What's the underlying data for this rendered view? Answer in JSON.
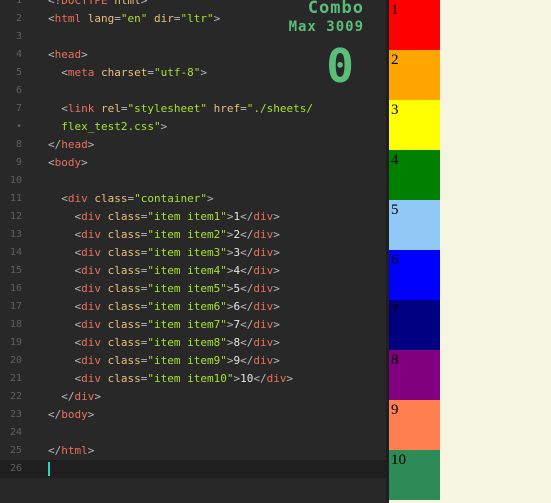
{
  "editor": {
    "lines": [
      {
        "n": "1",
        "segments": [
          [
            "p",
            "<!"
          ],
          [
            "t",
            "DOCTYPE"
          ],
          [
            "x",
            " "
          ],
          [
            "a",
            "html"
          ],
          [
            "p",
            ">"
          ]
        ]
      },
      {
        "n": "2",
        "segments": [
          [
            "p",
            "<"
          ],
          [
            "t",
            "html"
          ],
          [
            "x",
            " "
          ],
          [
            "a",
            "lang"
          ],
          [
            "p",
            "="
          ],
          [
            "s",
            "\"en\""
          ],
          [
            "x",
            " "
          ],
          [
            "a",
            "dir"
          ],
          [
            "p",
            "="
          ],
          [
            "s",
            "\"ltr\""
          ],
          [
            "p",
            ">"
          ]
        ]
      },
      {
        "n": "3",
        "segments": []
      },
      {
        "n": "4",
        "segments": [
          [
            "p",
            "<"
          ],
          [
            "t",
            "head"
          ],
          [
            "p",
            ">"
          ]
        ]
      },
      {
        "n": "5",
        "segments": [
          [
            "x",
            "  "
          ],
          [
            "p",
            "<"
          ],
          [
            "t",
            "meta"
          ],
          [
            "x",
            " "
          ],
          [
            "a",
            "charset"
          ],
          [
            "p",
            "="
          ],
          [
            "s",
            "\"utf-8\""
          ],
          [
            "p",
            ">"
          ]
        ]
      },
      {
        "n": "6",
        "segments": []
      },
      {
        "n": "7",
        "segments": [
          [
            "x",
            "  "
          ],
          [
            "p",
            "<"
          ],
          [
            "t",
            "link"
          ],
          [
            "x",
            " "
          ],
          [
            "a",
            "rel"
          ],
          [
            "p",
            "="
          ],
          [
            "s",
            "\"stylesheet\""
          ],
          [
            "x",
            " "
          ],
          [
            "a",
            "href"
          ],
          [
            "p",
            "="
          ],
          [
            "s",
            "\"./sheets/"
          ]
        ]
      },
      {
        "n": "•",
        "segments": [
          [
            "s",
            "  flex_test2.css\""
          ],
          [
            "p",
            ">"
          ]
        ]
      },
      {
        "n": "8",
        "segments": [
          [
            "p",
            "</"
          ],
          [
            "t",
            "head"
          ],
          [
            "p",
            ">"
          ]
        ]
      },
      {
        "n": "9",
        "segments": [
          [
            "p",
            "<"
          ],
          [
            "t",
            "body"
          ],
          [
            "p",
            ">"
          ]
        ]
      },
      {
        "n": "10",
        "segments": []
      },
      {
        "n": "11",
        "segments": [
          [
            "x",
            "  "
          ],
          [
            "p",
            "<"
          ],
          [
            "t",
            "div"
          ],
          [
            "x",
            " "
          ],
          [
            "a",
            "class"
          ],
          [
            "p",
            "="
          ],
          [
            "s",
            "\"container\""
          ],
          [
            "p",
            ">"
          ]
        ]
      },
      {
        "n": "12",
        "segments": [
          [
            "x",
            "    "
          ],
          [
            "p",
            "<"
          ],
          [
            "t",
            "div"
          ],
          [
            "x",
            " "
          ],
          [
            "a",
            "class"
          ],
          [
            "p",
            "="
          ],
          [
            "s",
            "\"item item1\""
          ],
          [
            "p",
            ">"
          ],
          [
            "x",
            "1"
          ],
          [
            "p",
            "</"
          ],
          [
            "t",
            "div"
          ],
          [
            "p",
            ">"
          ]
        ]
      },
      {
        "n": "13",
        "segments": [
          [
            "x",
            "    "
          ],
          [
            "p",
            "<"
          ],
          [
            "t",
            "div"
          ],
          [
            "x",
            " "
          ],
          [
            "a",
            "class"
          ],
          [
            "p",
            "="
          ],
          [
            "s",
            "\"item item2\""
          ],
          [
            "p",
            ">"
          ],
          [
            "x",
            "2"
          ],
          [
            "p",
            "</"
          ],
          [
            "t",
            "div"
          ],
          [
            "p",
            ">"
          ]
        ]
      },
      {
        "n": "14",
        "segments": [
          [
            "x",
            "    "
          ],
          [
            "p",
            "<"
          ],
          [
            "t",
            "div"
          ],
          [
            "x",
            " "
          ],
          [
            "a",
            "class"
          ],
          [
            "p",
            "="
          ],
          [
            "s",
            "\"item item3\""
          ],
          [
            "p",
            ">"
          ],
          [
            "x",
            "3"
          ],
          [
            "p",
            "</"
          ],
          [
            "t",
            "div"
          ],
          [
            "p",
            ">"
          ]
        ]
      },
      {
        "n": "15",
        "segments": [
          [
            "x",
            "    "
          ],
          [
            "p",
            "<"
          ],
          [
            "t",
            "div"
          ],
          [
            "x",
            " "
          ],
          [
            "a",
            "class"
          ],
          [
            "p",
            "="
          ],
          [
            "s",
            "\"item item4\""
          ],
          [
            "p",
            ">"
          ],
          [
            "x",
            "4"
          ],
          [
            "p",
            "</"
          ],
          [
            "t",
            "div"
          ],
          [
            "p",
            ">"
          ]
        ]
      },
      {
        "n": "16",
        "segments": [
          [
            "x",
            "    "
          ],
          [
            "p",
            "<"
          ],
          [
            "t",
            "div"
          ],
          [
            "x",
            " "
          ],
          [
            "a",
            "class"
          ],
          [
            "p",
            "="
          ],
          [
            "s",
            "\"item item5\""
          ],
          [
            "p",
            ">"
          ],
          [
            "x",
            "5"
          ],
          [
            "p",
            "</"
          ],
          [
            "t",
            "div"
          ],
          [
            "p",
            ">"
          ]
        ]
      },
      {
        "n": "17",
        "segments": [
          [
            "x",
            "    "
          ],
          [
            "p",
            "<"
          ],
          [
            "t",
            "div"
          ],
          [
            "x",
            " "
          ],
          [
            "a",
            "class"
          ],
          [
            "p",
            "="
          ],
          [
            "s",
            "\"item item6\""
          ],
          [
            "p",
            ">"
          ],
          [
            "x",
            "6"
          ],
          [
            "p",
            "</"
          ],
          [
            "t",
            "div"
          ],
          [
            "p",
            ">"
          ]
        ]
      },
      {
        "n": "18",
        "segments": [
          [
            "x",
            "    "
          ],
          [
            "p",
            "<"
          ],
          [
            "t",
            "div"
          ],
          [
            "x",
            " "
          ],
          [
            "a",
            "class"
          ],
          [
            "p",
            "="
          ],
          [
            "s",
            "\"item item7\""
          ],
          [
            "p",
            ">"
          ],
          [
            "x",
            "7"
          ],
          [
            "p",
            "</"
          ],
          [
            "t",
            "div"
          ],
          [
            "p",
            ">"
          ]
        ]
      },
      {
        "n": "19",
        "segments": [
          [
            "x",
            "    "
          ],
          [
            "p",
            "<"
          ],
          [
            "t",
            "div"
          ],
          [
            "x",
            " "
          ],
          [
            "a",
            "class"
          ],
          [
            "p",
            "="
          ],
          [
            "s",
            "\"item item8\""
          ],
          [
            "p",
            ">"
          ],
          [
            "x",
            "8"
          ],
          [
            "p",
            "</"
          ],
          [
            "t",
            "div"
          ],
          [
            "p",
            ">"
          ]
        ]
      },
      {
        "n": "20",
        "segments": [
          [
            "x",
            "    "
          ],
          [
            "p",
            "<"
          ],
          [
            "t",
            "div"
          ],
          [
            "x",
            " "
          ],
          [
            "a",
            "class"
          ],
          [
            "p",
            "="
          ],
          [
            "s",
            "\"item item9\""
          ],
          [
            "p",
            ">"
          ],
          [
            "x",
            "9"
          ],
          [
            "p",
            "</"
          ],
          [
            "t",
            "div"
          ],
          [
            "p",
            ">"
          ]
        ]
      },
      {
        "n": "21",
        "segments": [
          [
            "x",
            "    "
          ],
          [
            "p",
            "<"
          ],
          [
            "t",
            "div"
          ],
          [
            "x",
            " "
          ],
          [
            "a",
            "class"
          ],
          [
            "p",
            "="
          ],
          [
            "s",
            "\"item item10\""
          ],
          [
            "p",
            ">"
          ],
          [
            "x",
            "10"
          ],
          [
            "p",
            "</"
          ],
          [
            "t",
            "div"
          ],
          [
            "p",
            ">"
          ]
        ]
      },
      {
        "n": "22",
        "segments": [
          [
            "x",
            "  "
          ],
          [
            "p",
            "</"
          ],
          [
            "t",
            "div"
          ],
          [
            "p",
            ">"
          ]
        ]
      },
      {
        "n": "23",
        "segments": [
          [
            "p",
            "</"
          ],
          [
            "t",
            "body"
          ],
          [
            "p",
            ">"
          ]
        ]
      },
      {
        "n": "24",
        "segments": []
      },
      {
        "n": "25",
        "segments": [
          [
            "p",
            "</"
          ],
          [
            "t",
            "html"
          ],
          [
            "p",
            ">"
          ]
        ]
      },
      {
        "n": "26",
        "segments": []
      }
    ]
  },
  "combo": {
    "label": "Combo",
    "max_label": "Max 3009",
    "count": "0"
  },
  "preview": {
    "items": [
      {
        "label": "1",
        "color": "#ff0000"
      },
      {
        "label": "2",
        "color": "#ffa500"
      },
      {
        "label": "3",
        "color": "#ffff00"
      },
      {
        "label": "4",
        "color": "#008000"
      },
      {
        "label": "5",
        "color": "#90c8f6"
      },
      {
        "label": "6",
        "color": "#0000ff"
      },
      {
        "label": "7",
        "color": "#000080"
      },
      {
        "label": "8",
        "color": "#800080"
      },
      {
        "label": "9",
        "color": "#ff7f50"
      },
      {
        "label": "10",
        "color": "#2e8b57"
      }
    ]
  }
}
